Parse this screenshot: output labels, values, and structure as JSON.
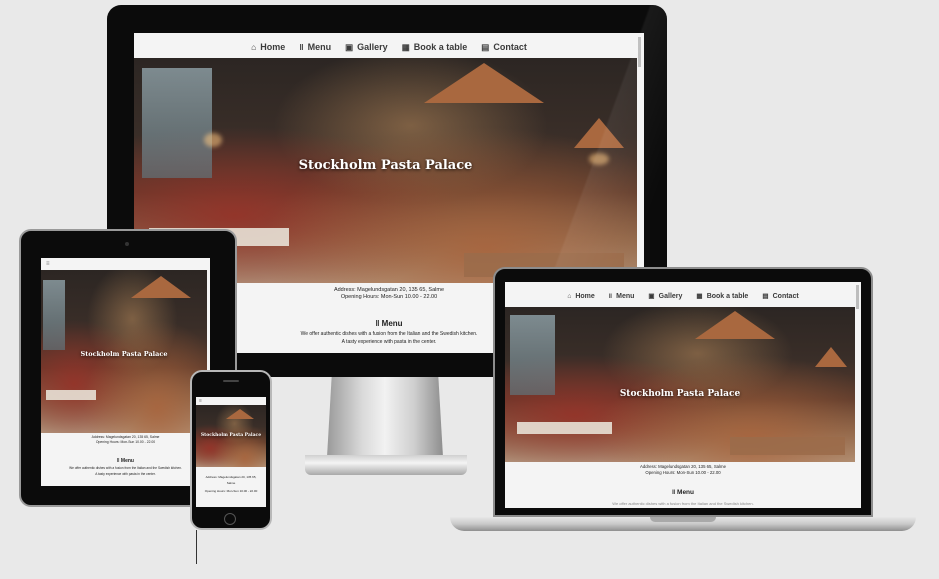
{
  "site": {
    "title": "Stockholm Pasta Palace",
    "nav": [
      {
        "icon": "home-icon",
        "glyph": "⌂",
        "label": "Home"
      },
      {
        "icon": "fork-knife-icon",
        "glyph": "†",
        "label": "Menu"
      },
      {
        "icon": "gallery-icon",
        "glyph": "▣",
        "label": "Gallery"
      },
      {
        "icon": "calendar-icon",
        "glyph": "▦",
        "label": "Book a table"
      },
      {
        "icon": "contact-icon",
        "glyph": "▤",
        "label": "Contact"
      }
    ],
    "address": "Address: Magelundsgatan 20, 135 65, Salme",
    "hours": "Opening Hours: Mon-Sun 10.00 - 22.00",
    "menu_heading": "Menu",
    "menu_line1": "We offer authentic dishes with a fusion from the Italian and the Swedish kitchen.",
    "menu_line2": "A tasty experience with pasta in the center.",
    "mobile_address_line1": "Address: Magelundsgatan 20, 135 65,",
    "mobile_address_line2": "Salme",
    "tablet_menu_line1": "We offer authentic dishes with a fusion from the Italian and the Swedish kitchen.",
    "tablet_menu_line2": "A tasty experience with pasta in the center."
  },
  "colors": {
    "bezel": "#0b0b0b",
    "background": "#e9e9e9",
    "nav_text": "#3b3b3b"
  }
}
